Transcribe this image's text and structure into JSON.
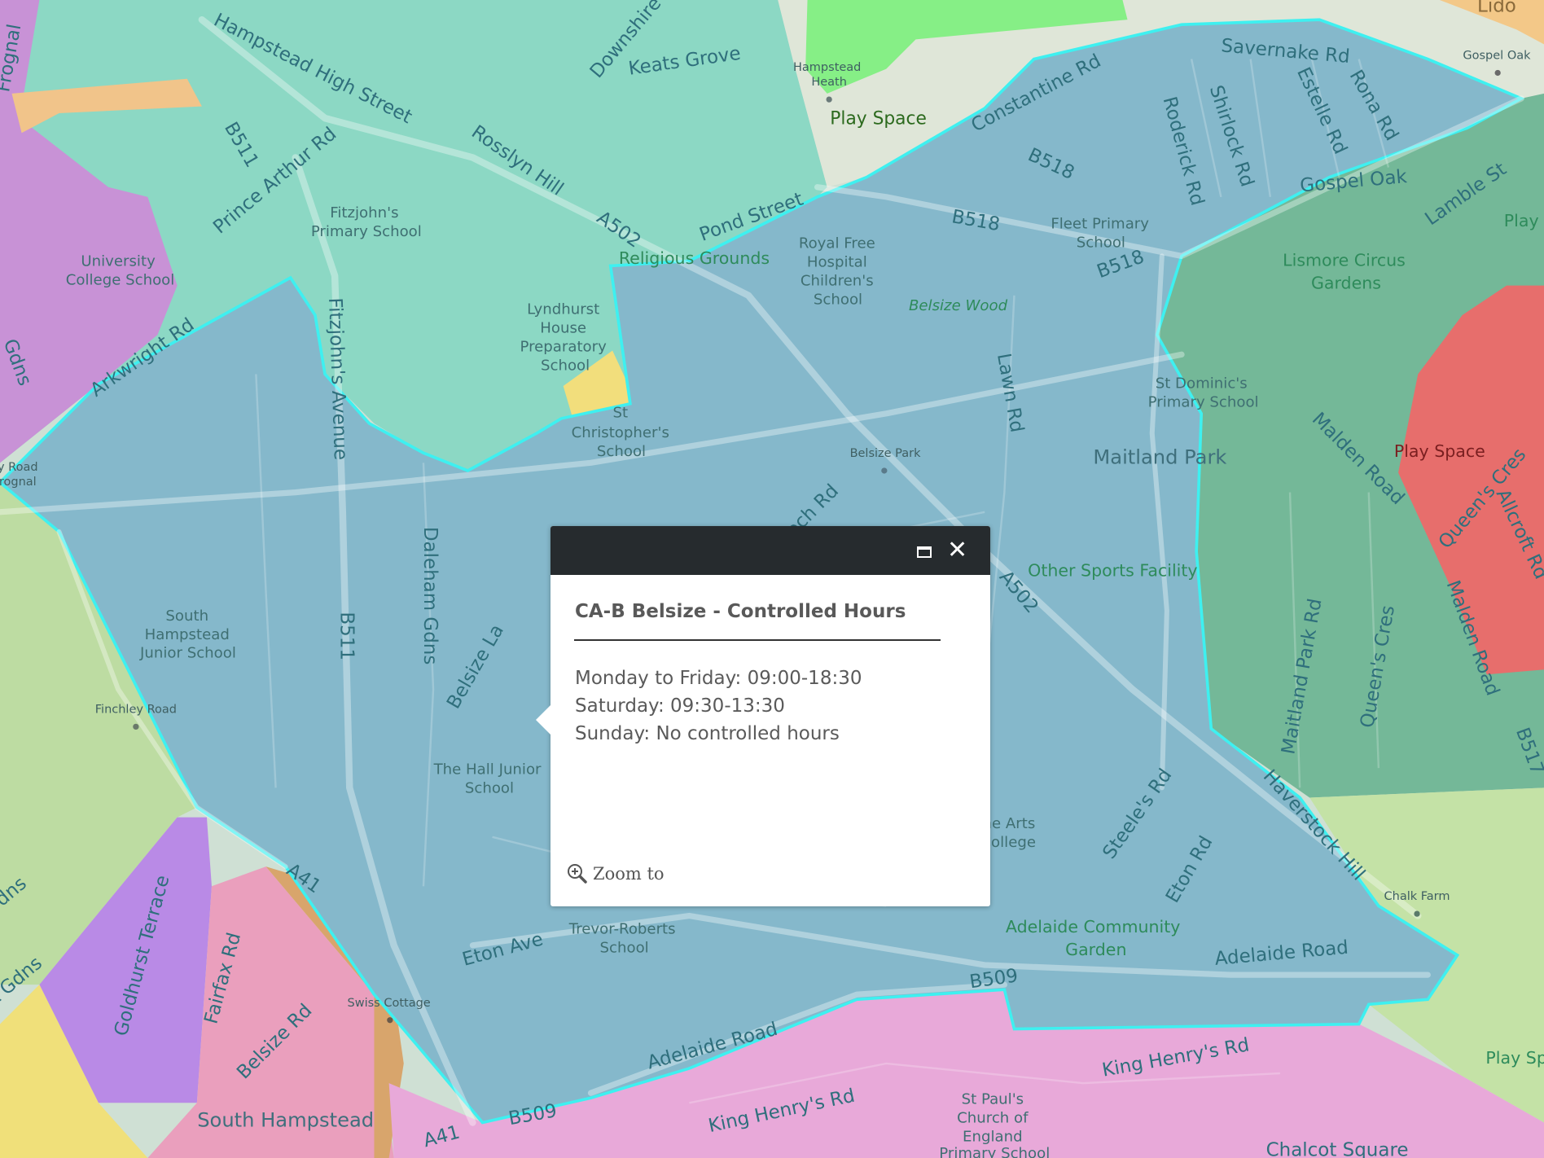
{
  "popup": {
    "title": "CA-B Belsize - Controlled Hours",
    "lines": [
      "Monday to Friday: 09:00-18:30",
      "Saturday: 09:30-13:30",
      "Sunday: No controlled hours"
    ],
    "zoom_label": "Zoom to",
    "icons": {
      "maximize": "maximize-icon",
      "close": "close-icon",
      "zoom": "zoom-in-icon"
    }
  },
  "map": {
    "zone_colors": {
      "belsize": "#85b8cb",
      "hampstead": "#8cd8c4",
      "gospel_oak": "#74b898",
      "red": "#e76e6c",
      "pink": "#e8a9d9",
      "light_green": "#bddca2",
      "purple": "#b98ae6",
      "boundary": "#3ef0f0"
    },
    "labels": [
      "Hampstead High Street",
      "Keats Grove",
      "Downshire",
      "B511",
      "Prince Arthur Rd",
      "Rosslyn Hill",
      "Fitzjohn's",
      "Primary School",
      "University",
      "College School",
      "A502",
      "Pond Street",
      "Religious Grounds",
      "Arkwright Rd",
      "Fitzjohn's Avenue",
      "Lyndhurst",
      "House",
      "Preparatory",
      "School",
      "St",
      "Christopher's",
      "School",
      "Hampstead",
      "Heath",
      "Play Space",
      "Constantine Rd",
      "Savernake Rd",
      "Roderick Rd",
      "Shirlock Rd",
      "Estelle Rd",
      "Rona Rd",
      "B518",
      "B518",
      "B518",
      "Gospel Oak",
      "Lamble St",
      "Play",
      "Gospel Oak",
      "Lido",
      "Royal Free",
      "Hospital",
      "Children's",
      "School",
      "Fleet Primary",
      "School",
      "Belsize Wood",
      "Lismore Circus",
      "Gardens",
      "Lawn Rd",
      "St Dominic's",
      "Primary School",
      "Belsize Park",
      "Maitland Park",
      "Malden Road",
      "Play Space",
      "Queen's Cres",
      "Allcroft Rd",
      "Glenloch Rd",
      "Other Sports Facility",
      "A502",
      "South",
      "Hampstead",
      "Junior School",
      "B511",
      "Daleham Gdns",
      "Belsize La",
      "Finchley Road",
      "The Hall Junior",
      "School",
      "Maitland Park Rd",
      "Queen's Cres",
      "Malden Road",
      "B517",
      "Haverstock Hill",
      "Steele's Rd",
      "Eton Rd",
      "The Arts",
      "College",
      "Chalk Farm",
      "Trevor-Roberts",
      "School",
      "Eton Ave",
      "Adelaide Community",
      "Garden",
      "Adelaide Road",
      "B509",
      "Adelaide Road",
      "A41",
      "Goldhurst Terrace",
      "Fairfax Rd",
      "Belsize Rd",
      "Swiss Cottage",
      "South Hampstead",
      "A41",
      "B509",
      "King Henry's Rd",
      "King Henry's Rd",
      "St Paul's",
      "Church of",
      "England",
      "Primary School",
      "Chalcot Square",
      "Play Sp",
      "Frognal",
      "Gdns",
      "y Road",
      "rognal",
      "dns",
      "t Gdns"
    ]
  }
}
